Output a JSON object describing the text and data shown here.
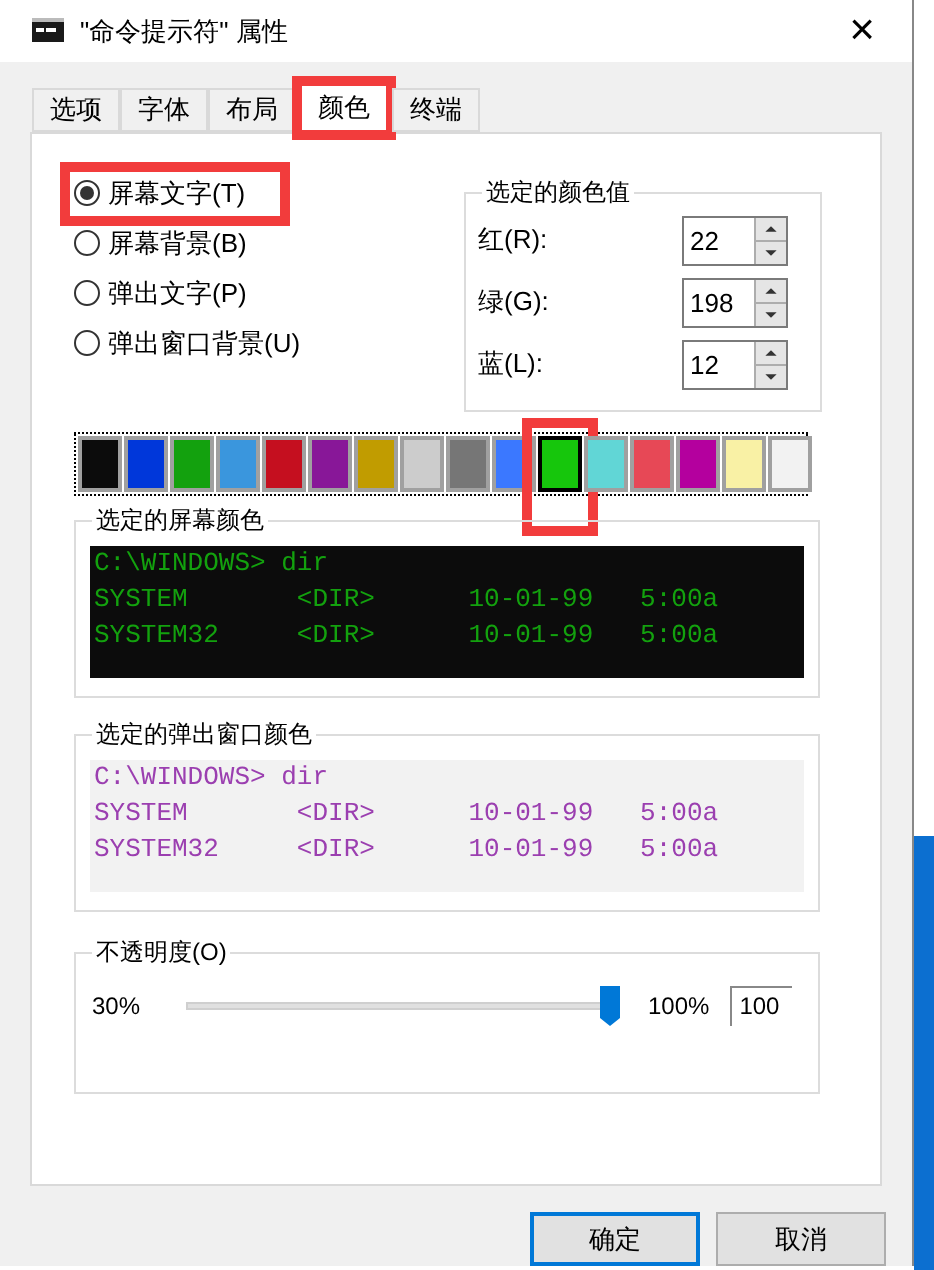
{
  "window": {
    "title": "\"命令提示符\" 属性",
    "close": "×"
  },
  "tabs": [
    {
      "label": "选项",
      "selected": false,
      "highlighted": false
    },
    {
      "label": "字体",
      "selected": false,
      "highlighted": false
    },
    {
      "label": "布局",
      "selected": false,
      "highlighted": false
    },
    {
      "label": "颜色",
      "selected": true,
      "highlighted": true
    },
    {
      "label": "终端",
      "selected": false,
      "highlighted": false
    }
  ],
  "targets": [
    {
      "label": "屏幕文字(T)",
      "selected": true,
      "highlighted": true
    },
    {
      "label": "屏幕背景(B)",
      "selected": false,
      "highlighted": false
    },
    {
      "label": "弹出文字(P)",
      "selected": false,
      "highlighted": false
    },
    {
      "label": "弹出窗口背景(U)",
      "selected": false,
      "highlighted": false
    }
  ],
  "color_values": {
    "title": "选定的颜色值",
    "fields": [
      {
        "label": "红(R):",
        "value": "22"
      },
      {
        "label": "绿(G):",
        "value": "198"
      },
      {
        "label": "蓝(L):",
        "value": "12"
      }
    ]
  },
  "swatches": [
    {
      "color": "#0c0c0c",
      "selected": false,
      "highlighted": false
    },
    {
      "color": "#0037da",
      "selected": false,
      "highlighted": false
    },
    {
      "color": "#13a10e",
      "selected": false,
      "highlighted": false
    },
    {
      "color": "#3a96dd",
      "selected": false,
      "highlighted": false
    },
    {
      "color": "#c50f1f",
      "selected": false,
      "highlighted": false
    },
    {
      "color": "#881798",
      "selected": false,
      "highlighted": false
    },
    {
      "color": "#c19c00",
      "selected": false,
      "highlighted": false
    },
    {
      "color": "#cccccc",
      "selected": false,
      "highlighted": false
    },
    {
      "color": "#767676",
      "selected": false,
      "highlighted": false
    },
    {
      "color": "#3b78ff",
      "selected": false,
      "highlighted": false
    },
    {
      "color": "#16c60c",
      "selected": true,
      "highlighted": true
    },
    {
      "color": "#61d6d6",
      "selected": false,
      "highlighted": false
    },
    {
      "color": "#e74856",
      "selected": false,
      "highlighted": false
    },
    {
      "color": "#b4009e",
      "selected": false,
      "highlighted": false
    },
    {
      "color": "#f9f1a5",
      "selected": false,
      "highlighted": false
    },
    {
      "color": "#f2f2f2",
      "selected": false,
      "highlighted": false
    }
  ],
  "previews": [
    {
      "title": "选定的屏幕颜色",
      "kind": "screen",
      "lines": [
        "C:\\WINDOWS> dir",
        "SYSTEM       <DIR>      10-01-99   5:00a",
        "SYSTEM32     <DIR>      10-01-99   5:00a"
      ]
    },
    {
      "title": "选定的弹出窗口颜色",
      "kind": "popup",
      "lines": [
        "C:\\WINDOWS> dir",
        "SYSTEM       <DIR>      10-01-99   5:00a",
        "SYSTEM32     <DIR>      10-01-99   5:00a"
      ]
    }
  ],
  "opacity": {
    "title": "不透明度(O)",
    "min_label": "30%",
    "max_label": "100%",
    "level": 1,
    "value": "100"
  },
  "buttons": [
    {
      "label": "确定",
      "default": true
    },
    {
      "label": "取消",
      "default": false
    }
  ]
}
